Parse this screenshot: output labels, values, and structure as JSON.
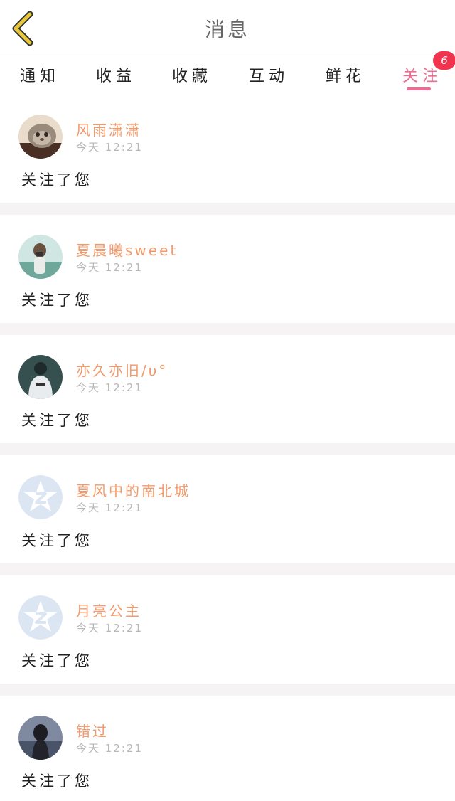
{
  "header": {
    "title": "消息",
    "back_icon": "chevron-left-icon",
    "back_icon_color": "#e8c83a"
  },
  "tabs": [
    {
      "label": "通知",
      "active": false
    },
    {
      "label": "收益",
      "active": false
    },
    {
      "label": "收藏",
      "active": false
    },
    {
      "label": "互动",
      "active": false
    },
    {
      "label": "鲜花",
      "active": false
    },
    {
      "label": "关注",
      "active": true,
      "badge": "6"
    }
  ],
  "colors": {
    "accent_pink": "#ee6b93",
    "badge_red": "#f2334d",
    "name_orange": "#f29a6b",
    "separator": "#f5f3f4"
  },
  "notifications": [
    {
      "name": "风雨潇潇",
      "time": "今天  12:21",
      "message": "关注了您",
      "avatar": "cat-photo-avatar"
    },
    {
      "name": "夏晨曦sweet",
      "time": "今天  12:21",
      "message": "关注了您",
      "avatar": "girl-camera-photo-avatar"
    },
    {
      "name": "亦久亦旧/υ°",
      "time": "今天  12:21",
      "message": "关注了您",
      "avatar": "person-back-photo-avatar"
    },
    {
      "name": "夏风中的南北城",
      "time": "今天  12:21",
      "message": "关注了您",
      "avatar": "default-qzone-avatar"
    },
    {
      "name": "月亮公主",
      "time": "今天  12:21",
      "message": "关注了您",
      "avatar": "default-qzone-avatar"
    },
    {
      "name": "错过",
      "time": "今天  12:21",
      "message": "关注了您",
      "avatar": "girl-back-photo-avatar"
    }
  ]
}
